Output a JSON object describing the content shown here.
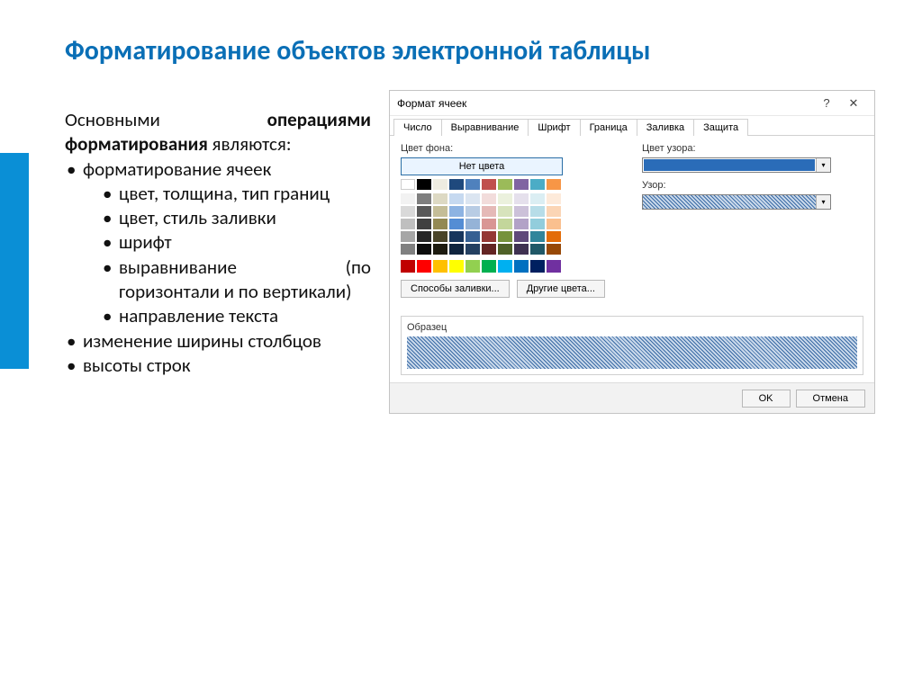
{
  "slide": {
    "title": "Форматирование объектов электронной таблицы",
    "intro_part1": "Основными ",
    "intro_bold": "операциями форматирования",
    "intro_part2": " являются:",
    "bullets": [
      {
        "label": "форматирование ячеек",
        "children": [
          "цвет, толщина, тип границ",
          "цвет, стиль заливки",
          "шрифт",
          "выравнивание (по горизонтали и по вертикали)",
          "направление текста"
        ]
      },
      {
        "label": "изменение ширины столбцов"
      },
      {
        "label": "высоты строк"
      }
    ]
  },
  "dialog": {
    "title": "Формат ячеек",
    "tabs": [
      "Число",
      "Выравнивание",
      "Шрифт",
      "Граница",
      "Заливка",
      "Защита"
    ],
    "active_tab": "Заливка",
    "bg_label": "Цвет фона:",
    "no_color": "Нет цвета",
    "pattern_color_label": "Цвет узора:",
    "pattern_label": "Узор:",
    "fill_effects": "Способы заливки...",
    "other_colors": "Другие цвета...",
    "sample_label": "Образец",
    "ok": "OK",
    "cancel": "Отмена"
  },
  "theme_colors_row1": [
    "#ffffff",
    "#000000",
    "#eeece1",
    "#1f497d",
    "#4f81bd",
    "#c0504d",
    "#9bbb59",
    "#8064a2",
    "#4bacc6",
    "#f79646"
  ],
  "theme_grid": [
    [
      "#f2f2f2",
      "#7f7f7f",
      "#ddd9c3",
      "#c6d9f0",
      "#dbe5f1",
      "#f2dcdb",
      "#ebf1dd",
      "#e5e0ec",
      "#dbeef3",
      "#fdeada"
    ],
    [
      "#d9d9d9",
      "#595959",
      "#c4bd97",
      "#8db3e2",
      "#b8cce4",
      "#e5b9b7",
      "#d7e3bc",
      "#ccc1d9",
      "#b7dde8",
      "#fbd5b5"
    ],
    [
      "#bfbfbf",
      "#404040",
      "#938953",
      "#548dd4",
      "#95b3d7",
      "#d99694",
      "#c3d69b",
      "#b2a2c7",
      "#92cddc",
      "#fac08f"
    ],
    [
      "#a6a6a6",
      "#262626",
      "#494429",
      "#17365d",
      "#366092",
      "#953734",
      "#76923c",
      "#5f497a",
      "#31859b",
      "#e36c09"
    ],
    [
      "#808080",
      "#0d0d0d",
      "#1d1b10",
      "#0f243e",
      "#244061",
      "#632423",
      "#4f6128",
      "#3f3151",
      "#205867",
      "#974806"
    ]
  ],
  "standard_colors": [
    "#c00000",
    "#ff0000",
    "#ffc000",
    "#ffff00",
    "#92d050",
    "#00b050",
    "#00b0f0",
    "#0070c0",
    "#002060",
    "#7030a0"
  ]
}
